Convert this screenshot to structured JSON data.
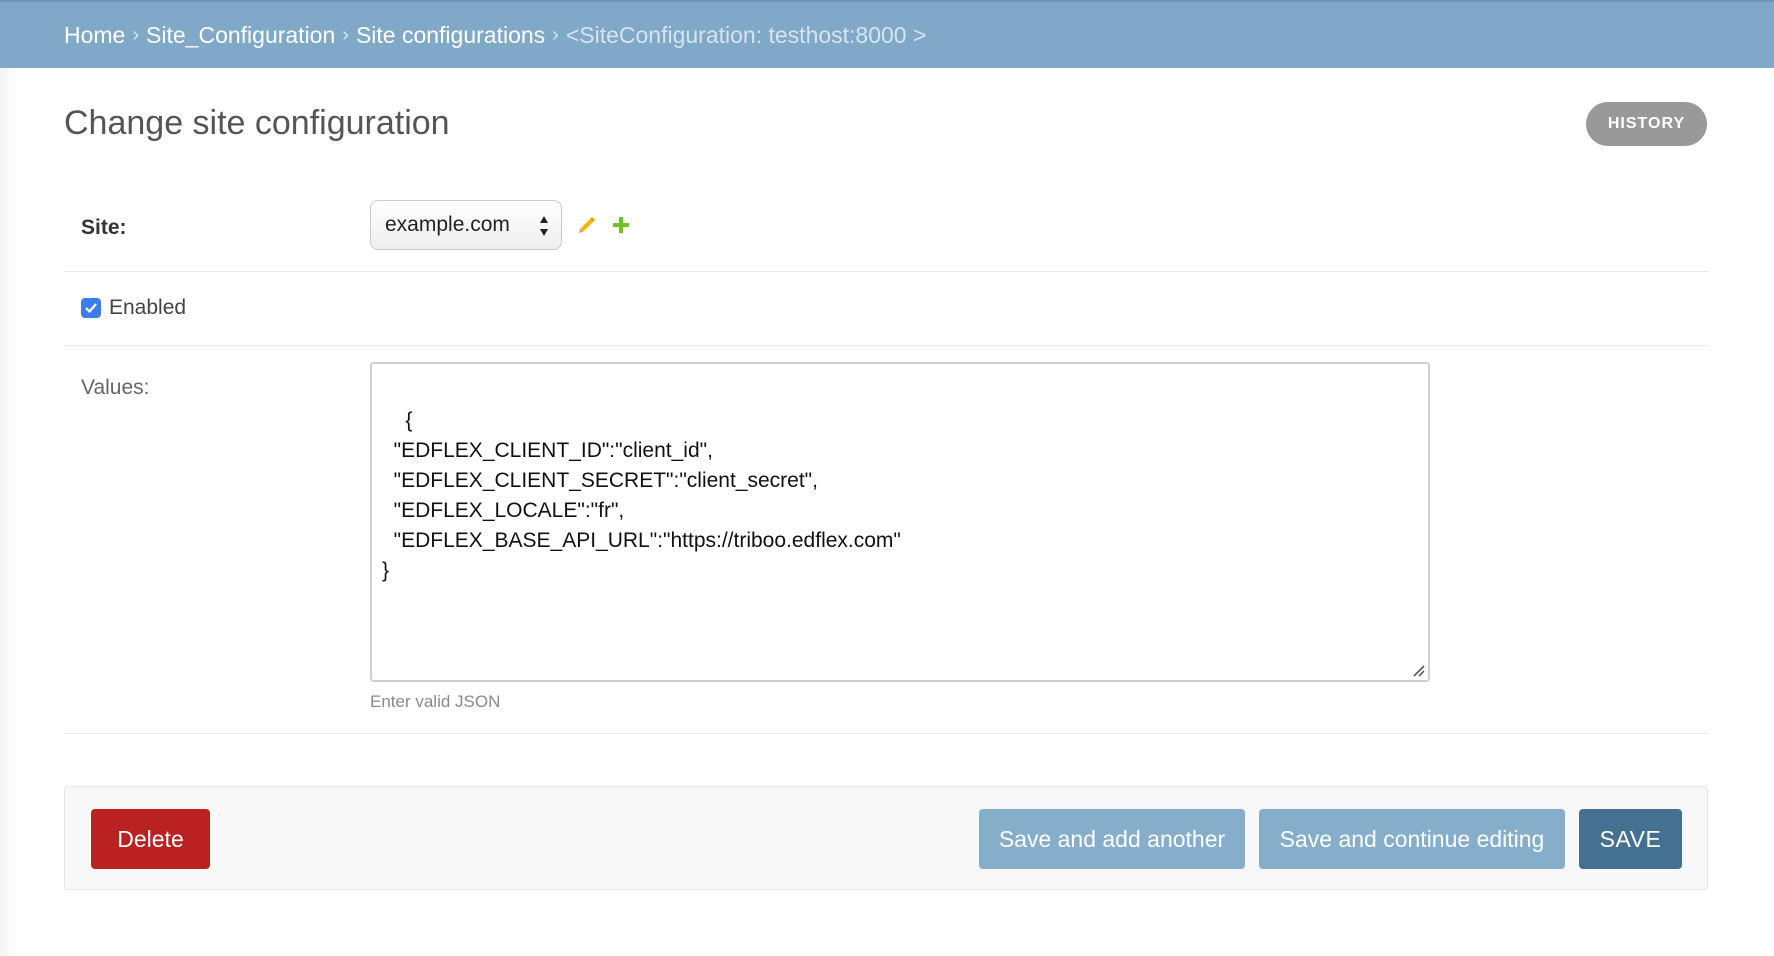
{
  "breadcrumbs": {
    "items": [
      "Home",
      "Site_Configuration",
      "Site configurations"
    ],
    "separator": "›",
    "current": "<SiteConfiguration: testhost:8000 >"
  },
  "page": {
    "title": "Change site configuration",
    "history_label": "HISTORY"
  },
  "form": {
    "site": {
      "label": "Site:",
      "selected": "example.com",
      "edit_icon": "pencil-icon",
      "add_icon": "plus-icon"
    },
    "enabled": {
      "label": "Enabled",
      "checked": true
    },
    "values": {
      "label": "Values:",
      "content": "{\n  \"EDFLEX_CLIENT_ID\":\"client_id\",\n  \"EDFLEX_CLIENT_SECRET\":\"client_secret\",\n  \"EDFLEX_LOCALE\":\"fr\",\n  \"EDFLEX_BASE_API_URL\":\"https://triboo.edflex.com\"\n}",
      "help": "Enter valid JSON"
    }
  },
  "actions": {
    "delete": "Delete",
    "save_add_another": "Save and add another",
    "save_continue": "Save and continue editing",
    "save": "SAVE"
  },
  "colors": {
    "header_bg": "#80a9c8",
    "delete": "#ba2121",
    "secondary": "#85aecb",
    "primary": "#447192",
    "checkbox": "#3c7ee6"
  }
}
